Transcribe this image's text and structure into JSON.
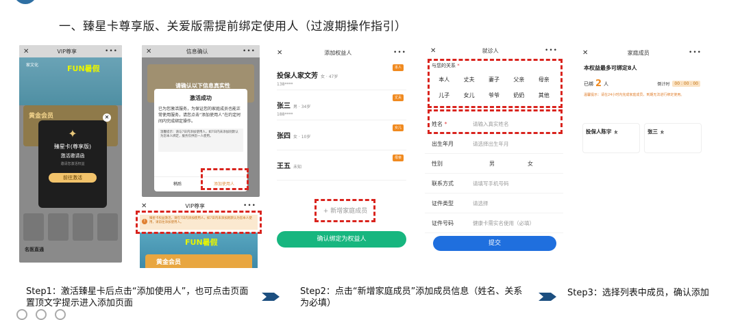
{
  "title": "一、臻星卡尊享版、关爱版需提前绑定使用人（过渡期操作指引）",
  "phone1": {
    "bar_title": "VIP尊享",
    "banner_logo": "家文化",
    "banner_fun": "FUN暑假",
    "card_label": "黄金会员",
    "modal_title": "臻星卡(尊享版)",
    "modal_sub": "激活邀请函",
    "modal_note": "邀请您激活权益",
    "modal_go": "前往激活",
    "section": "名医直通"
  },
  "phone2": {
    "bar_title": "信息确认",
    "banner_text": "请确认以下信息真实性",
    "dialog_title": "激活成功",
    "dialog_body": "已为您激活服务，为保证您的家庭成员也能正常使用服务，请您点击“添加使用人”在约定时间内完成绑定操作。",
    "dialog_tip": "温馨提示：请与7日内添加使用人，如7日内未添加则默认为您本人绑定，服务仅供您一人使用。",
    "later": "稍后",
    "add_user": "添加使用人"
  },
  "phone2b": {
    "bar_title": "VIP尊享",
    "notice": "臻星卡权益激活，请在7日内添加使用人，如7日内未添加则默认为您本人使用，请前往添加使用人。",
    "banner_fun": "FUN暑假",
    "gold": "黄金会员"
  },
  "phone3": {
    "bar_title": "添加权益人",
    "members": [
      {
        "name": "投保人家文芳",
        "sub": "女 · 47岁",
        "phone": "138****",
        "tag": "本人"
      },
      {
        "name": "张三",
        "sub": "男 · 34岁",
        "phone": "188****",
        "tag": "丈夫"
      },
      {
        "name": "张四",
        "sub": "女 · 10岁",
        "phone": "",
        "tag": "女儿"
      },
      {
        "name": "王五",
        "sub": "未知",
        "phone": "",
        "tag": "母亲"
      }
    ],
    "add_member": "+ 新增家庭成员",
    "confirm": "确认绑定为权益人"
  },
  "phone4": {
    "bar_title": "就诊人",
    "relation_label": "与您的关系",
    "relations": [
      "本人",
      "丈夫",
      "妻子",
      "父亲",
      "母亲",
      "儿子",
      "女儿",
      "爷爷",
      "奶奶",
      "其他"
    ],
    "name_label": "姓名",
    "name_placeholder": "请输入真实姓名",
    "birth_label": "出生年月",
    "birth_placeholder": "请选择出生年月",
    "gender_label": "性别",
    "male": "男",
    "female": "女",
    "contact_label": "联系方式",
    "contact_placeholder": "请填写手机号码",
    "idtype_label": "证件类型",
    "idtype_placeholder": "请选择",
    "idno_label": "证件号码",
    "idno_placeholder": "健康卡需实名使用（必填）",
    "submit": "提交"
  },
  "phone5": {
    "bar_title": "家庭成员",
    "heading": "本权益最多可绑定8人",
    "bound_prefix": "已绑",
    "bound_count": "2",
    "bound_suffix": "人",
    "countdown_label": "倒计时",
    "countdown": "00 : 00 : 00",
    "hint": "温馨提示：请在24小时内完成家庭成员，到期无法进行绑定使用。",
    "cards": [
      {
        "name": "投保人陈宇",
        "sub": "女"
      },
      {
        "name": "张三",
        "sub": "女"
      }
    ]
  },
  "steps": {
    "step1": "Step1：激活臻星卡后点击“添加使用人”，也可点击页面置顶文字提示进入添加页面",
    "step2": "Step2：点击“新增家庭成员”添加成员信息（姓名、关系为必填）",
    "step3": "Step3：选择列表中成员，确认添加"
  },
  "colors": {
    "highlight": "#d9231d",
    "green": "#17b67f",
    "blue": "#1f6fde",
    "orange": "#f08a20",
    "arrow": "#1c4f80"
  }
}
